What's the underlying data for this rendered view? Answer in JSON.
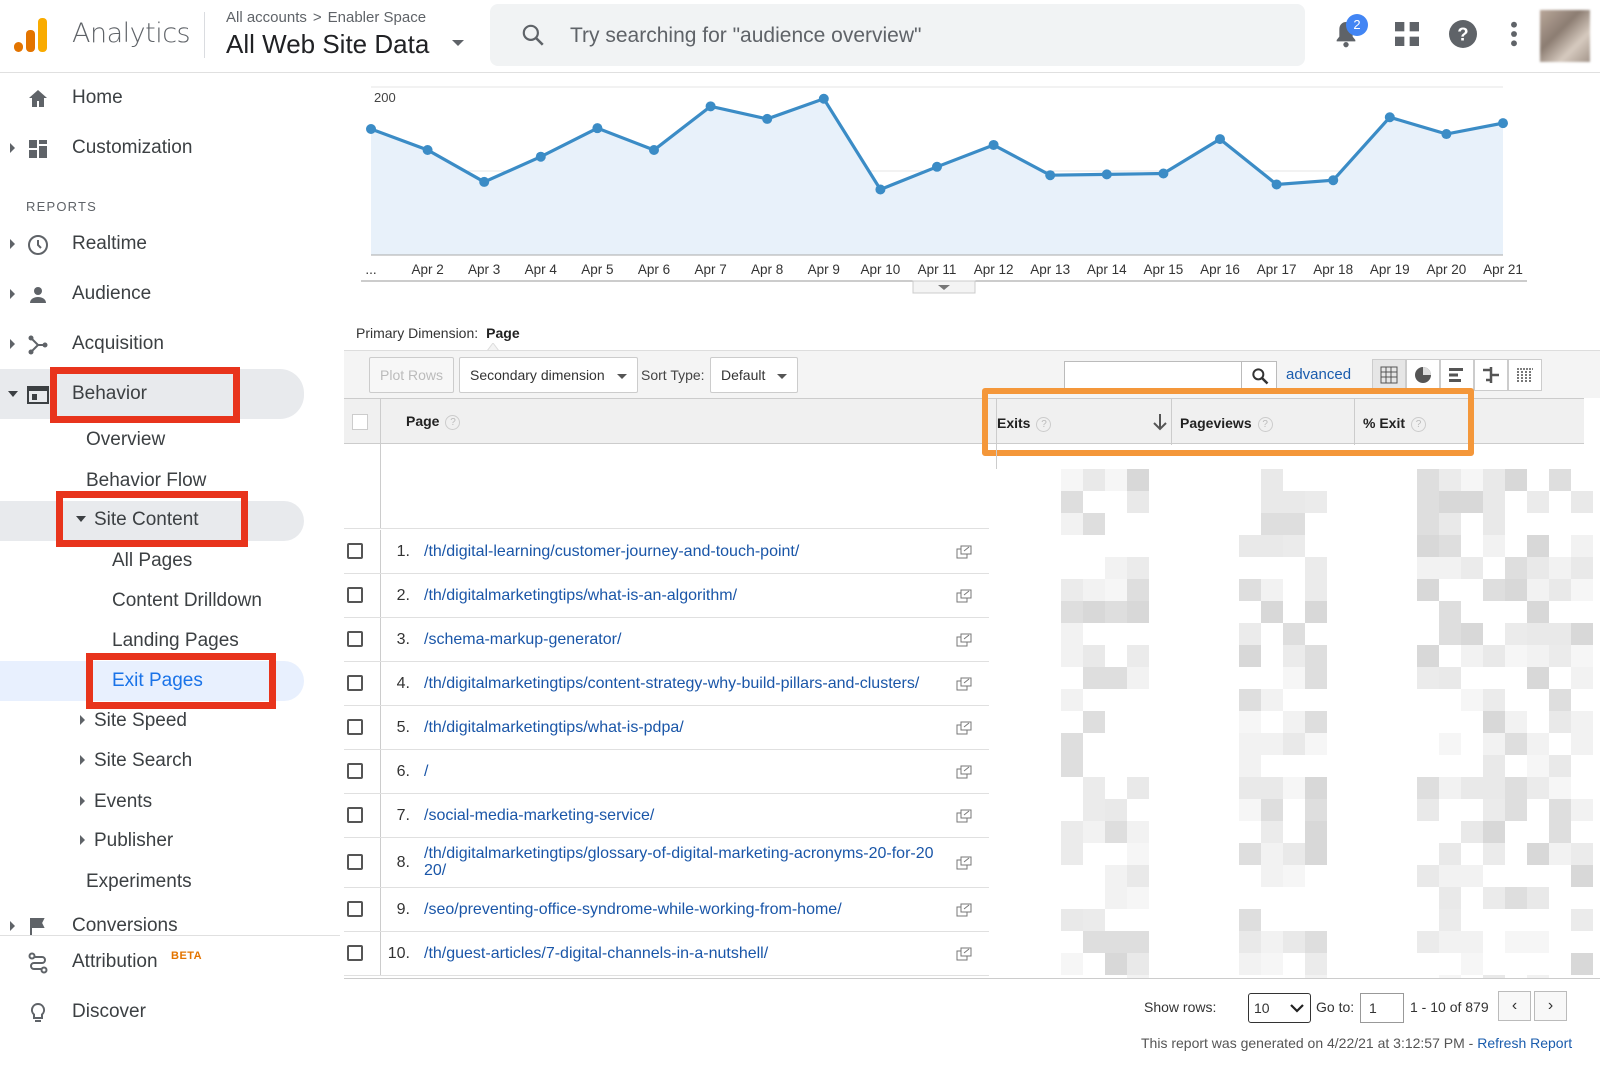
{
  "app": {
    "name": "Analytics",
    "breadcrumb": [
      "All accounts",
      "Enabler Space"
    ],
    "view_title": "All Web Site Data",
    "search_placeholder": "Try searching for \"audience overview\"",
    "notification_count": "2",
    "brand_colors": {
      "logo_dark": "#e37400",
      "logo_light": "#f9ab00"
    }
  },
  "sidebar": {
    "home": "Home",
    "customization": "Customization",
    "reports_heading": "REPORTS",
    "realtime": "Realtime",
    "audience": "Audience",
    "acquisition": "Acquisition",
    "behavior": "Behavior",
    "behavior_sub": {
      "overview": "Overview",
      "behavior_flow": "Behavior Flow",
      "site_content": "Site Content",
      "site_content_sub": [
        "All Pages",
        "Content Drilldown",
        "Landing Pages",
        "Exit Pages"
      ],
      "site_speed": "Site Speed",
      "site_search": "Site Search",
      "events": "Events",
      "publisher": "Publisher",
      "experiments": "Experiments"
    },
    "conversions": "Conversions",
    "attribution": "Attribution",
    "attribution_badge": "BETA",
    "discover": "Discover"
  },
  "chart_data": {
    "type": "area",
    "x": [
      "...",
      "Apr 2",
      "Apr 3",
      "Apr 4",
      "Apr 5",
      "Apr 6",
      "Apr 7",
      "Apr 8",
      "Apr 9",
      "Apr 10",
      "Apr 11",
      "Apr 12",
      "Apr 13",
      "Apr 14",
      "Apr 15",
      "Apr 16",
      "Apr 17",
      "Apr 18",
      "Apr 19",
      "Apr 20",
      "Apr 21"
    ],
    "series": [
      {
        "values": [
          150,
          125,
          87,
          117,
          151,
          125,
          177,
          162,
          186,
          78,
          105,
          131,
          95,
          96,
          97,
          138,
          84,
          89,
          164,
          144,
          157
        ]
      }
    ],
    "yticks": [
      "200",
      "100"
    ],
    "ylim": [
      0,
      200
    ],
    "color": "#3b8cc6",
    "fill": "#e8f1fa"
  },
  "table": {
    "primary_dimension_label": "Primary Dimension:",
    "primary_dimension_value": "Page",
    "plot_rows": "Plot Rows",
    "secondary_dimension": "Secondary dimension",
    "sort_type_label": "Sort Type:",
    "sort_type_value": "Default",
    "advanced": "advanced",
    "headers": {
      "page": "Page",
      "exits": "Exits",
      "pageviews": "Pageviews",
      "pct_exit": "% Exit"
    },
    "rows": [
      {
        "num": "1.",
        "page": "/th/digital-learning/customer-journey-and-touch-point/"
      },
      {
        "num": "2.",
        "page": "/th/digitalmarketingtips/what-is-an-algorithm/"
      },
      {
        "num": "3.",
        "page": "/schema-markup-generator/"
      },
      {
        "num": "4.",
        "page": "/th/digitalmarketingtips/content-strategy-why-build-pillars-and-clusters/"
      },
      {
        "num": "5.",
        "page": "/th/digitalmarketingtips/what-is-pdpa/"
      },
      {
        "num": "6.",
        "page": "/"
      },
      {
        "num": "7.",
        "page": "/social-media-marketing-service/"
      },
      {
        "num": "8.",
        "page": "/th/digitalmarketingtips/glossary-of-digital-marketing-acronyms-20-for-20",
        "page_line2": "20/"
      },
      {
        "num": "9.",
        "page": "/seo/preventing-office-syndrome-while-working-from-home/"
      },
      {
        "num": "10.",
        "page": "/th/guest-articles/7-digital-channels-in-a-nutshell/"
      }
    ]
  },
  "footer": {
    "show_rows_label": "Show rows:",
    "show_rows_value": "10",
    "goto_label": "Go to:",
    "goto_value": "1",
    "range": "1 - 10 of 879",
    "prev": "‹",
    "next": "›",
    "generated_text": "This report was generated on 4/22/21 at 3:12:57 PM - ",
    "refresh_link": "Refresh Report"
  }
}
